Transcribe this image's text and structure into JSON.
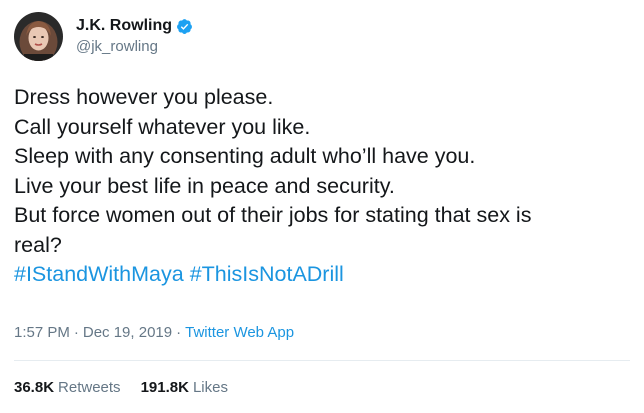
{
  "author": {
    "display_name": "J.K. Rowling",
    "handle": "@jk_rowling",
    "verified_icon": "verified-badge-icon",
    "verified_color": "#1da1f2"
  },
  "tweet": {
    "lines": [
      "Dress however you please.",
      "Call yourself whatever you like.",
      "Sleep with any consenting adult who’ll have you.",
      "Live your best life in peace and security.",
      "But force women out of their jobs for stating that sex is",
      "real?"
    ],
    "hashtags": [
      "#IStandWithMaya",
      "#ThisIsNotADrill"
    ],
    "hashtag_color": "#1b95e0"
  },
  "meta": {
    "time": "1:57 PM",
    "separator": "·",
    "date": "Dec 19, 2019",
    "source": "Twitter Web App"
  },
  "stats": {
    "retweets_count": "36.8K",
    "retweets_label": "Retweets",
    "likes_count": "191.8K",
    "likes_label": "Likes"
  },
  "colors": {
    "text": "#14171a",
    "secondary": "#657786",
    "link": "#1b95e0",
    "divider": "#e6ecf0"
  }
}
